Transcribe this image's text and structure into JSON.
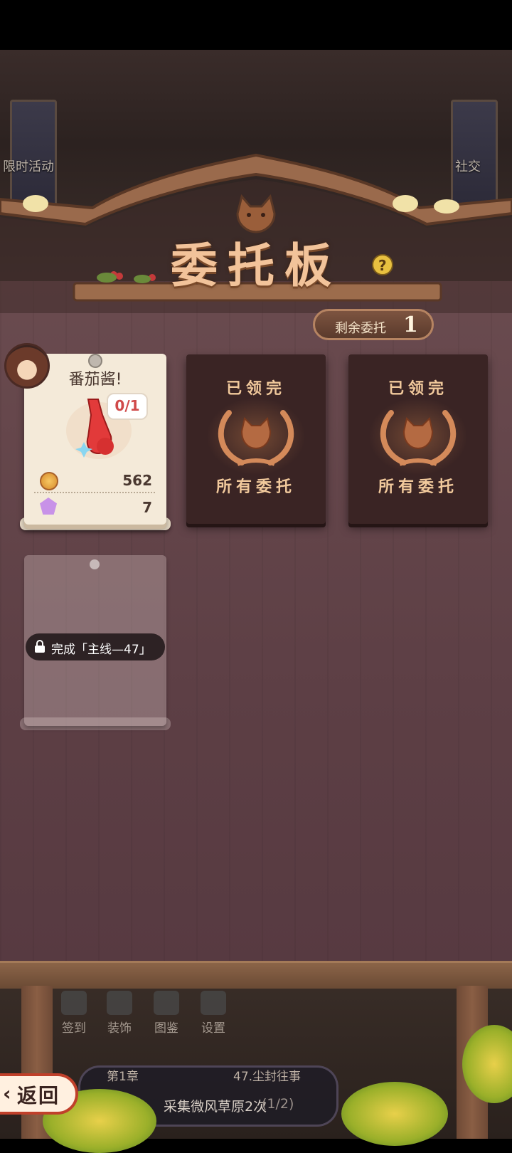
{
  "board": {
    "title": "委托板",
    "remaining_label": "剩余委托",
    "remaining_count": "1"
  },
  "side": {
    "left_label": "限时活动",
    "right_label": "社交"
  },
  "active_card": {
    "title": "番茄酱!",
    "progress": "0/1",
    "rewards": [
      {
        "icon": "coin-icon",
        "value": "562"
      },
      {
        "icon": "gem-icon",
        "value": "7"
      }
    ]
  },
  "done_cards": [
    {
      "top_text": "已领完",
      "bottom_text": "所有委托",
      "icon": "cat-laurel-icon"
    },
    {
      "top_text": "已领完",
      "bottom_text": "所有委托",
      "icon": "cat-laurel-icon"
    }
  ],
  "locked_card": {
    "lock_text": "完成「主线—47」"
  },
  "bottom_menu": {
    "items": [
      "签到",
      "装饰",
      "图鉴",
      "设置"
    ]
  },
  "quest": {
    "chapter": "第1章",
    "chapter_name": "47.尘封往事",
    "text": "采集微风草原2次",
    "progress": "(1/2)"
  },
  "back_button": {
    "label": "返回"
  },
  "colors": {
    "board": "#5d3f45",
    "title": "#f2c39a",
    "done_card": "#3a2424",
    "accent_red": "#d04a4a"
  }
}
